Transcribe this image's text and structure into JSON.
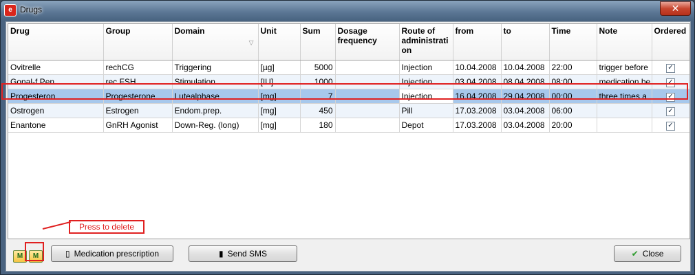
{
  "window": {
    "title": "Drugs",
    "close_glyph": "✕",
    "app_icon": "drugs-app-icon"
  },
  "columns": [
    "Drug",
    "Group",
    "Domain",
    "Unit",
    "Sum",
    "Dosage frequency",
    "Route of administrati on",
    "from",
    "to",
    "Time",
    "Note",
    "Ordered"
  ],
  "sort_glyph": "▽",
  "rows": [
    {
      "drug": "Ovitrelle",
      "group": "rechCG",
      "domain": "Triggering",
      "unit": "[µg]",
      "sum": "5000",
      "dosage": "",
      "route": "Injection",
      "from": "10.04.2008",
      "to": "10.04.2008",
      "time": "22:00",
      "note": "trigger before",
      "ordered": true
    },
    {
      "drug": "Gonal-f Pen",
      "group": "rec FSH",
      "domain": "Stimulation",
      "unit": "[IU]",
      "sum": "1000",
      "dosage": "",
      "route": "Injection",
      "from": "03.04.2008",
      "to": "08.04.2008",
      "time": "08:00",
      "note": "medication be",
      "ordered": true
    },
    {
      "drug": "Progesteron",
      "group": "Progesterone",
      "domain": "Lutealphase",
      "unit": "[mg]",
      "sum": "7",
      "dosage": "",
      "route": "Injection",
      "from": "16.04.2008",
      "to": "29.04.2008",
      "time": "00:00",
      "note": "three times a",
      "ordered": true
    },
    {
      "drug": "Ostrogen",
      "group": "Estrogen",
      "domain": "Endom.prep.",
      "unit": "[mg]",
      "sum": "450",
      "dosage": "",
      "route": "Pill",
      "from": "17.03.2008",
      "to": "03.04.2008",
      "time": "06:00",
      "note": "",
      "ordered": true
    },
    {
      "drug": "Enantone",
      "group": "GnRH Agonist",
      "domain": "Down-Reg. (long)",
      "unit": "[mg]",
      "sum": "180",
      "dosage": "",
      "route": "Depot",
      "from": "17.03.2008",
      "to": "03.04.2008",
      "time": "20:00",
      "note": "",
      "ordered": true
    }
  ],
  "selected_row_index": 2,
  "check_glyph": "✓",
  "toolbar": {
    "add_label": "M",
    "delete_label": "M",
    "prescription_label": "Medication prescription",
    "sms_label": "Send SMS",
    "close_label": "Close",
    "check_icon_glyph": "✔"
  },
  "annotation": {
    "text": "Press to delete"
  }
}
